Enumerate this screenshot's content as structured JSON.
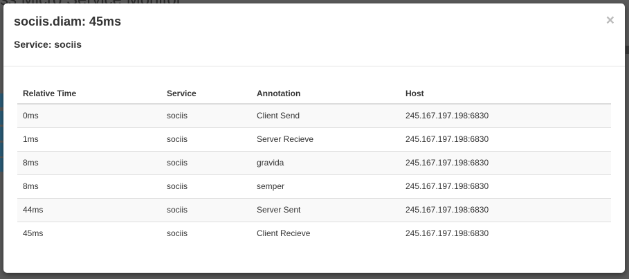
{
  "background": {
    "partial_title": "ss Micro Service Monitor"
  },
  "modal": {
    "title": "sociis.diam: 45ms",
    "subtitle": "Service: sociis",
    "close_label": "×"
  },
  "table": {
    "columns": [
      "Relative Time",
      "Service",
      "Annotation",
      "Host"
    ],
    "rows": [
      [
        "0ms",
        "sociis",
        "Client Send",
        "245.167.197.198:6830"
      ],
      [
        "1ms",
        "sociis",
        "Server Recieve",
        "245.167.197.198:6830"
      ],
      [
        "8ms",
        "sociis",
        "gravida",
        "245.167.197.198:6830"
      ],
      [
        "8ms",
        "sociis",
        "semper",
        "245.167.197.198:6830"
      ],
      [
        "44ms",
        "sociis",
        "Server Sent",
        "245.167.197.198:6830"
      ],
      [
        "45ms",
        "sociis",
        "Client Recieve",
        "245.167.197.198:6830"
      ]
    ]
  },
  "colors": {
    "backdrop": "#5b5b5b",
    "header_border": "#e5e5e5",
    "stripe": "#f9f9f9"
  }
}
